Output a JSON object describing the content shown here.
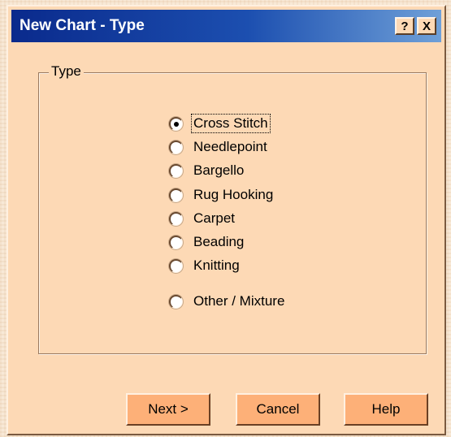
{
  "window": {
    "title": "New Chart - Type",
    "help_button": "?",
    "close_button": "X"
  },
  "group": {
    "label": "Type",
    "selected": "Cross Stitch",
    "options": [
      {
        "label": "Cross Stitch",
        "checked": true
      },
      {
        "label": "Needlepoint",
        "checked": false
      },
      {
        "label": "Bargello",
        "checked": false
      },
      {
        "label": "Rug Hooking",
        "checked": false
      },
      {
        "label": "Carpet",
        "checked": false
      },
      {
        "label": "Beading",
        "checked": false
      },
      {
        "label": "Knitting",
        "checked": false
      },
      {
        "label": "Other / Mixture",
        "checked": false
      }
    ]
  },
  "buttons": {
    "next": "Next >",
    "cancel": "Cancel",
    "help": "Help"
  },
  "colors": {
    "title_bar_start": "#0a2a8c",
    "title_bar_end": "#6fa0d8",
    "dialog_background": "#fdd9b5",
    "button_background": "#fdb078"
  }
}
